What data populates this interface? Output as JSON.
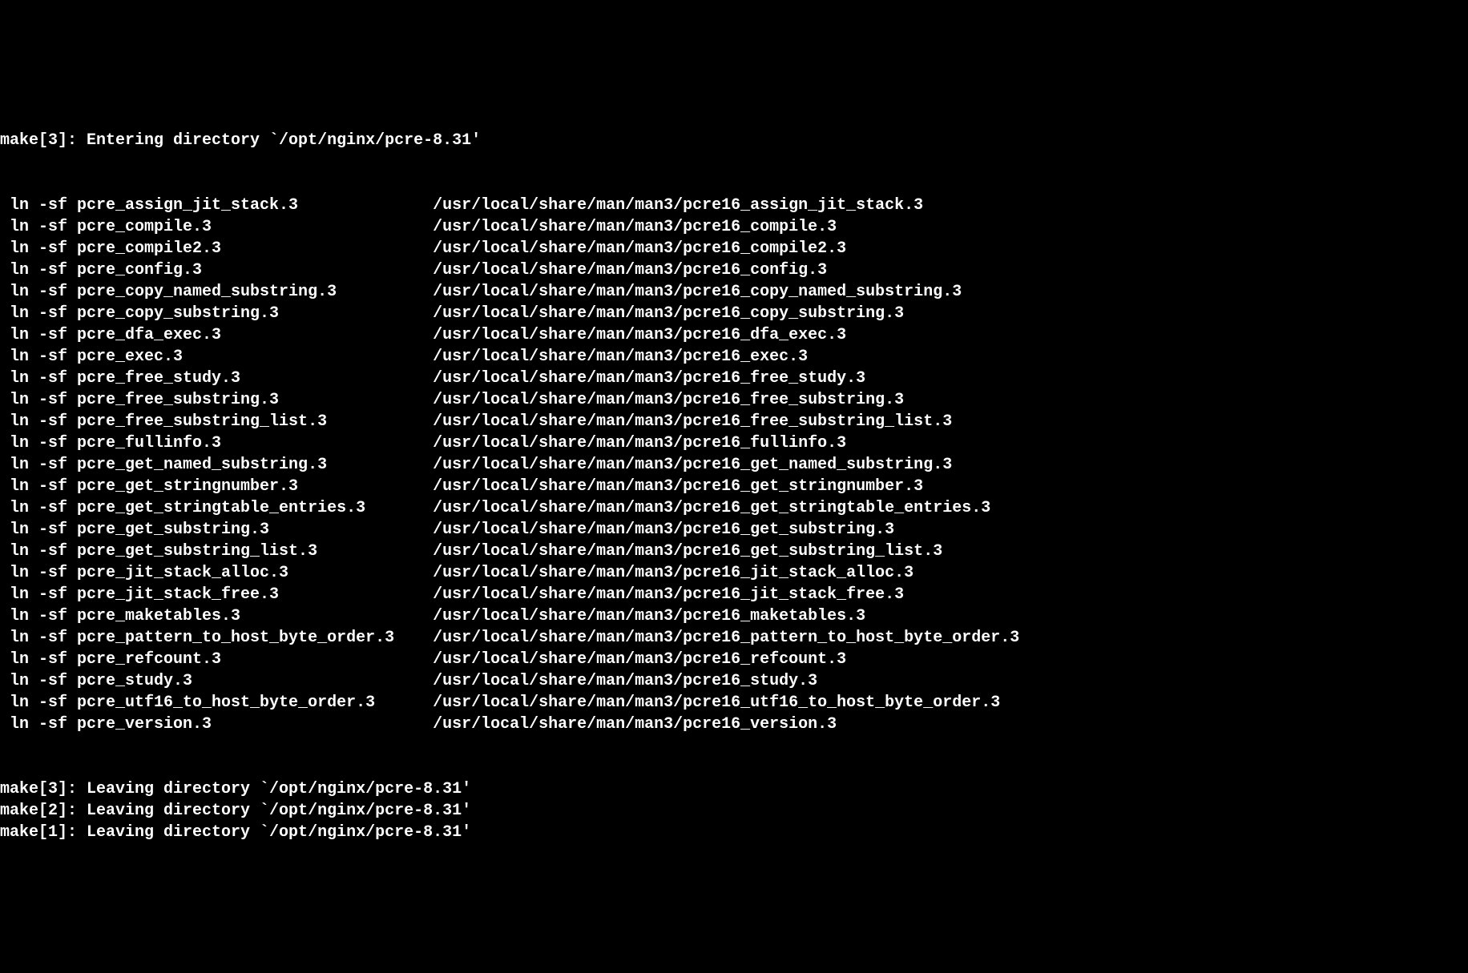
{
  "terminal": {
    "header_line": "make[3]: Entering directory `/opt/nginx/pcre-8.31'",
    "ln_prefix": " ln -sf ",
    "target_path_prefix": "/usr/local/share/man/man3/",
    "symlinks": [
      {
        "src": "pcre_assign_jit_stack.3",
        "dst": "pcre16_assign_jit_stack.3"
      },
      {
        "src": "pcre_compile.3",
        "dst": "pcre16_compile.3"
      },
      {
        "src": "pcre_compile2.3",
        "dst": "pcre16_compile2.3"
      },
      {
        "src": "pcre_config.3",
        "dst": "pcre16_config.3"
      },
      {
        "src": "pcre_copy_named_substring.3",
        "dst": "pcre16_copy_named_substring.3"
      },
      {
        "src": "pcre_copy_substring.3",
        "dst": "pcre16_copy_substring.3"
      },
      {
        "src": "pcre_dfa_exec.3",
        "dst": "pcre16_dfa_exec.3"
      },
      {
        "src": "pcre_exec.3",
        "dst": "pcre16_exec.3"
      },
      {
        "src": "pcre_free_study.3",
        "dst": "pcre16_free_study.3"
      },
      {
        "src": "pcre_free_substring.3",
        "dst": "pcre16_free_substring.3"
      },
      {
        "src": "pcre_free_substring_list.3",
        "dst": "pcre16_free_substring_list.3"
      },
      {
        "src": "pcre_fullinfo.3",
        "dst": "pcre16_fullinfo.3"
      },
      {
        "src": "pcre_get_named_substring.3",
        "dst": "pcre16_get_named_substring.3"
      },
      {
        "src": "pcre_get_stringnumber.3",
        "dst": "pcre16_get_stringnumber.3"
      },
      {
        "src": "pcre_get_stringtable_entries.3",
        "dst": "pcre16_get_stringtable_entries.3"
      },
      {
        "src": "pcre_get_substring.3",
        "dst": "pcre16_get_substring.3"
      },
      {
        "src": "pcre_get_substring_list.3",
        "dst": "pcre16_get_substring_list.3"
      },
      {
        "src": "pcre_jit_stack_alloc.3",
        "dst": "pcre16_jit_stack_alloc.3"
      },
      {
        "src": "pcre_jit_stack_free.3",
        "dst": "pcre16_jit_stack_free.3"
      },
      {
        "src": "pcre_maketables.3",
        "dst": "pcre16_maketables.3"
      },
      {
        "src": "pcre_pattern_to_host_byte_order.3",
        "dst": "pcre16_pattern_to_host_byte_order.3"
      },
      {
        "src": "pcre_refcount.3",
        "dst": "pcre16_refcount.3"
      },
      {
        "src": "pcre_study.3",
        "dst": "pcre16_study.3"
      },
      {
        "src": "pcre_utf16_to_host_byte_order.3",
        "dst": "pcre16_utf16_to_host_byte_order.3"
      },
      {
        "src": "pcre_version.3",
        "dst": "pcre16_version.3"
      }
    ],
    "src_column_width": 37,
    "footer_lines": [
      "make[3]: Leaving directory `/opt/nginx/pcre-8.31'",
      "make[2]: Leaving directory `/opt/nginx/pcre-8.31'",
      "make[1]: Leaving directory `/opt/nginx/pcre-8.31'"
    ]
  }
}
